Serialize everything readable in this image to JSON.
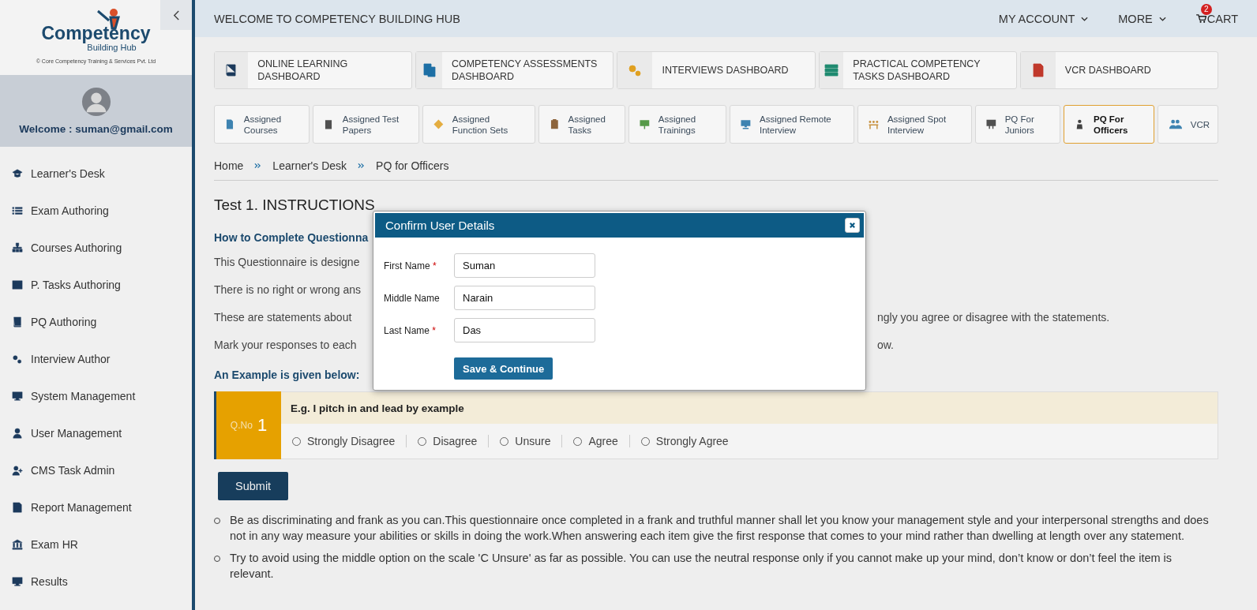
{
  "sidebar": {
    "logo": {
      "title": "Competency",
      "subtitle": "Building Hub",
      "copyright": "© Core Competency Training & Services Pvt. Ltd"
    },
    "welcome": "Welcome : suman@gmail.com",
    "items": [
      {
        "label": "Learner's Desk"
      },
      {
        "label": "Exam Authoring"
      },
      {
        "label": "Courses Authoring"
      },
      {
        "label": "P. Tasks Authoring"
      },
      {
        "label": "PQ Authoring"
      },
      {
        "label": "Interview Author"
      },
      {
        "label": "System Management"
      },
      {
        "label": "User Management"
      },
      {
        "label": "CMS Task Admin"
      },
      {
        "label": "Report Management"
      },
      {
        "label": "Exam HR"
      },
      {
        "label": "Results"
      }
    ]
  },
  "header": {
    "title": "WELCOME TO COMPETENCY BUILDING HUB",
    "menus": [
      "MY ACCOUNT",
      "MORE"
    ],
    "cart": {
      "label": "CART",
      "count": "2"
    }
  },
  "dashboards": [
    {
      "label": "ONLINE LEARNING DASHBOARD"
    },
    {
      "label": "COMPETENCY ASSESSMENTS DASHBOARD"
    },
    {
      "label": "INTERVIEWS DASHBOARD"
    },
    {
      "label": "PRACTICAL COMPETENCY TASKS DASHBOARD"
    },
    {
      "label": "VCR DASHBOARD"
    }
  ],
  "tabs": [
    {
      "label": "Assigned Courses",
      "selected": false
    },
    {
      "label": "Assigned Test Papers",
      "selected": false
    },
    {
      "label": "Assigned Function Sets",
      "selected": false
    },
    {
      "label": "Assigned Tasks",
      "selected": false
    },
    {
      "label": "Assigned Trainings",
      "selected": false
    },
    {
      "label": "Assigned Remote Interview",
      "selected": false
    },
    {
      "label": "Assigned Spot Interview",
      "selected": false
    },
    {
      "label": "PQ For Juniors",
      "selected": false
    },
    {
      "label": "PQ For Officers",
      "selected": true
    },
    {
      "label": "VCR",
      "selected": false
    }
  ],
  "breadcrumb": [
    "Home",
    "Learner's Desk",
    "PQ for Officers"
  ],
  "page": {
    "title": "Test 1. INSTRUCTIONS",
    "subheading": "How to Complete Questionna",
    "lines": [
      {
        "left": "This Questionnaire is designe"
      },
      {
        "left": "There is no right or wrong ans"
      },
      {
        "left": "These are statements about",
        "right": "ngly you agree or disagree with the statements."
      },
      {
        "left": "Mark your responses to each",
        "right": "ow."
      }
    ],
    "example_heading": "An Example is given below:",
    "question": {
      "qno_label": "Q.No",
      "qno": "1",
      "text": "E.g. I pitch in and lead by example",
      "options": [
        {
          "label": "Strongly Disagree",
          "selected": false
        },
        {
          "label": "Disagree",
          "selected": false
        },
        {
          "label": "Unsure",
          "selected": false
        },
        {
          "label": "Agree",
          "selected": false
        },
        {
          "label": "Strongly Agree",
          "selected": false
        }
      ]
    },
    "submit": "Submit",
    "bullets": [
      "Be as discriminating and frank as you can.This questionnaire once completed in a frank and truthful manner shall let you know your management style and your interpersonal strengths and does not in any way measure your abilities or skills in doing the work.When answering each item give the first response that comes to your mind rather than dwelling at length over any statement.",
      "Try to avoid using the middle option on the scale 'C Unsure' as far as possible. You can use the neutral response only if you cannot make up your mind, don’t know or don’t feel the item is relevant."
    ]
  },
  "dialog": {
    "title": "Confirm User Details",
    "fields": [
      {
        "label": "First Name",
        "required_mark": "*",
        "value": "Suman"
      },
      {
        "label": "Middle Name",
        "value": "Narain"
      },
      {
        "label": "Last Name",
        "required_mark": "*",
        "value": "Das"
      }
    ],
    "button": "Save & Continue"
  }
}
